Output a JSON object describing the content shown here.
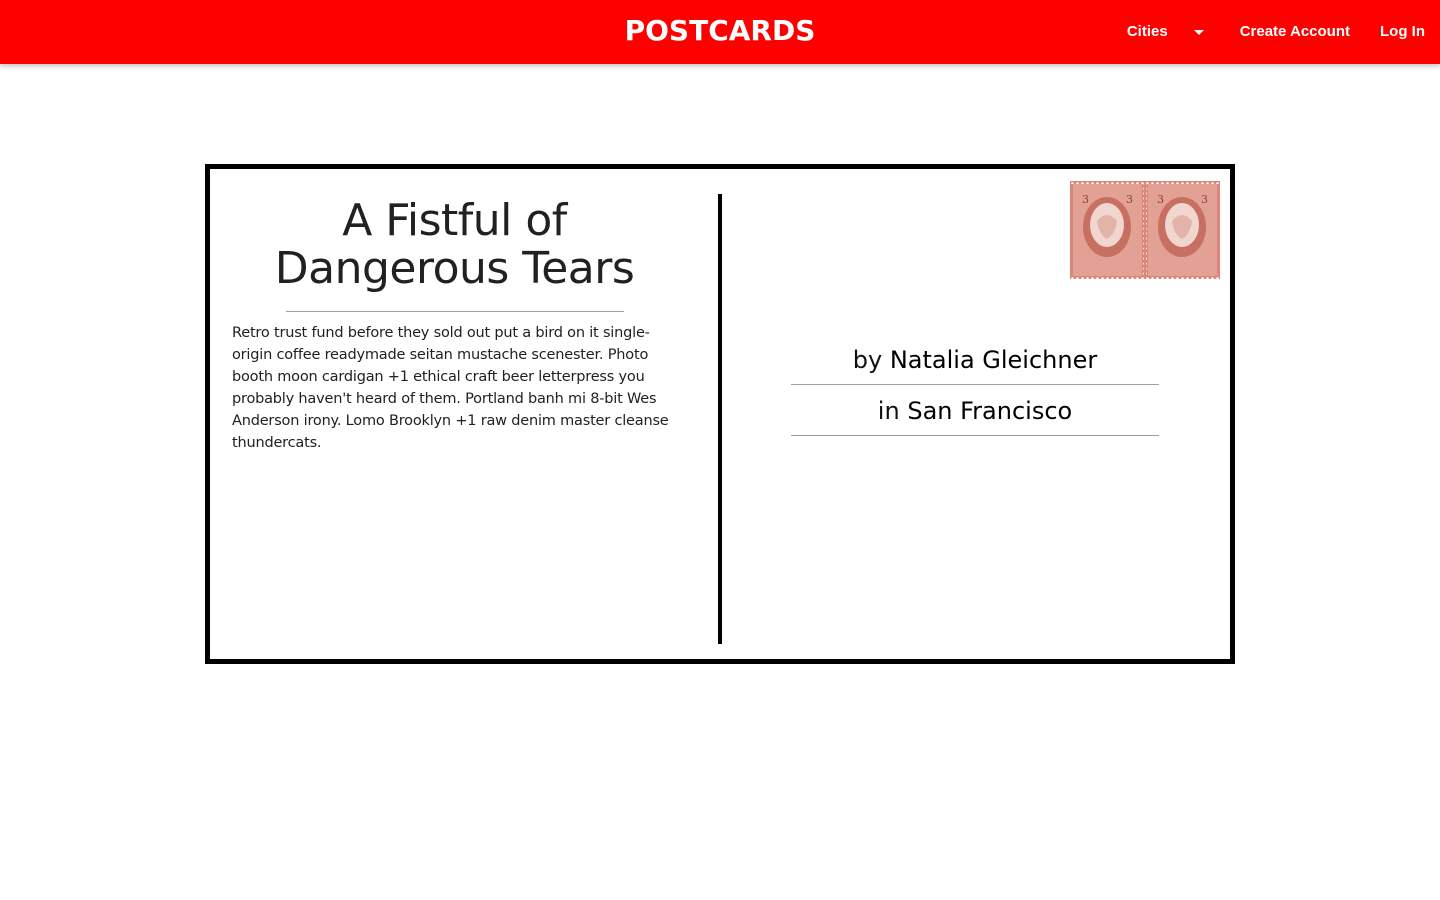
{
  "navbar": {
    "brand": "POSTCARDS",
    "cities_label": "Cities",
    "create_account_label": "Create Account",
    "login_label": "Log In",
    "background_color": "#ff0000"
  },
  "post": {
    "title": "A Fistful of Dangerous Tears",
    "body": "Retro trust fund before they sold out put a bird on it single-origin coffee readymade seitan mustache scenester. Photo booth moon cardigan +1 ethical craft beer letterpress you probably haven't heard of them. Portland banh mi 8-bit Wes Anderson irony. Lomo Brooklyn +1 raw denim master cleanse thundercats.",
    "by_prefix": "by",
    "author": "Natalia Gleichner",
    "in_prefix": "in",
    "city": "San Francisco"
  },
  "stamp": {
    "icon": "postage-stamp-icon",
    "denomination": "3",
    "color": "#d9877a"
  }
}
